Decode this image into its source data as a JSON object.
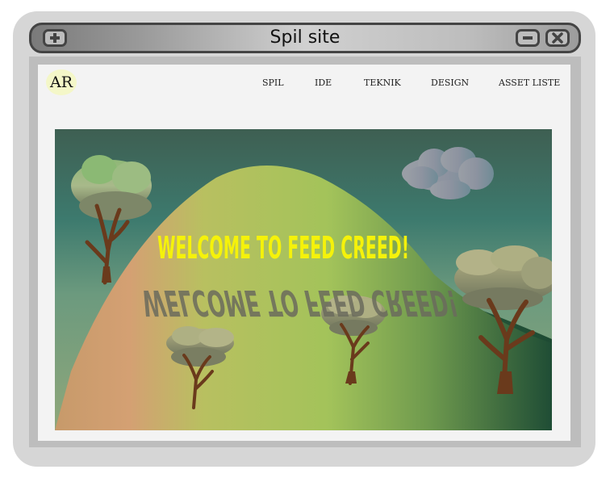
{
  "window": {
    "title": "Spil site",
    "buttons": {
      "add_icon": "plus-icon",
      "minimize_icon": "minus-icon",
      "close_icon": "x-icon"
    }
  },
  "site": {
    "logo_text": "AR",
    "nav": [
      "SPIL",
      "IDE",
      "TEKNIK",
      "DESIGN",
      "ASSET LISTE"
    ]
  },
  "hero": {
    "headline": "WELCOME TO FEED CREED!",
    "headline_color": "#f5f20a"
  }
}
